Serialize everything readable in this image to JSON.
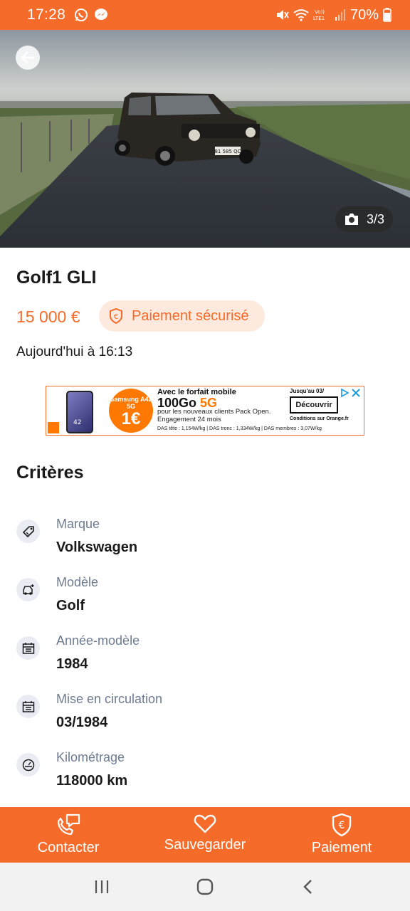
{
  "status_bar": {
    "time": "17:28",
    "battery": "70%",
    "network": "LTE1"
  },
  "photo": {
    "counter": "3/3",
    "license_plate": "81 585 QC"
  },
  "listing": {
    "title": "Golf1 GLI",
    "price": "15 000 €",
    "secure_badge": "Paiement sécurisé",
    "date": "Aujourd'hui à 16:13"
  },
  "ad": {
    "phone_label": "42",
    "circle_model": "Samsung A42 5G",
    "circle_price": "1€",
    "line1": "Avec le forfait mobile",
    "line2_main": "100Go",
    "line2_accent": "5G",
    "line3": "pour les nouveaux clients Pack Open. Engagement 24 mois",
    "das": "DAS tête : 1,154W/kg | DAS tronc : 1,334W/kg | DAS membres : 3,07W/kg",
    "until": "Jusqu'au 03/",
    "cta": "Découvrir",
    "conditions": "Conditions sur Orange.fr"
  },
  "criteria": {
    "title": "Critères",
    "items": [
      {
        "label": "Marque",
        "value": "Volkswagen",
        "icon": "tag-icon"
      },
      {
        "label": "Modèle",
        "value": "Golf",
        "icon": "car-icon"
      },
      {
        "label": "Année-modèle",
        "value": "1984",
        "icon": "calendar-icon"
      },
      {
        "label": "Mise en circulation",
        "value": "03/1984",
        "icon": "calendar-icon"
      },
      {
        "label": "Kilométrage",
        "value": "118000 km",
        "icon": "speedometer-icon"
      }
    ]
  },
  "actions": {
    "contact": "Contacter",
    "save": "Sauvegarder",
    "payment": "Paiement"
  },
  "colors": {
    "brand": "#f56b2a",
    "badge_bg": "#fde9dd",
    "label_grey": "#6d7b91"
  }
}
